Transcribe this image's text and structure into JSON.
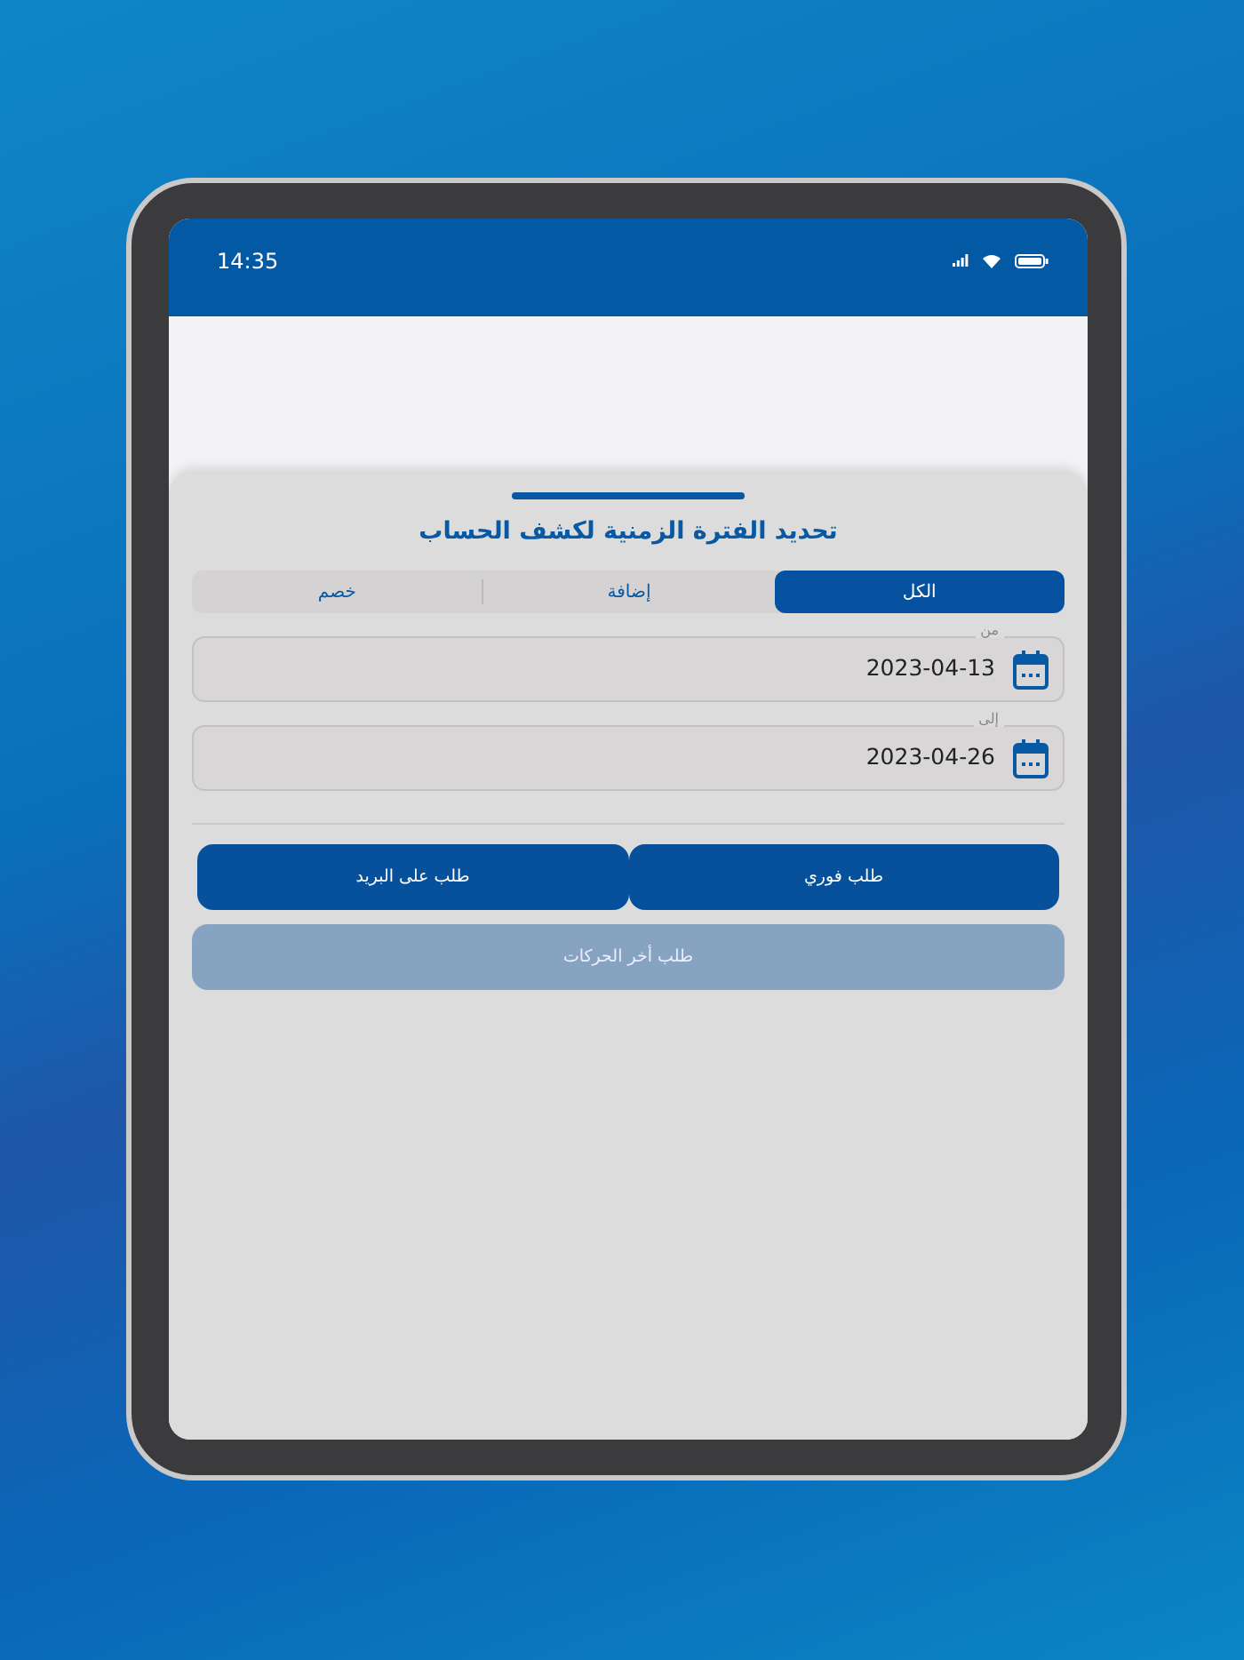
{
  "status_bar": {
    "time": "14:35"
  },
  "sheet": {
    "title": "تحديد الفترة الزمنية لكشف الحساب",
    "tabs": [
      {
        "label": "الكل",
        "selected": true
      },
      {
        "label": "إضافة",
        "selected": false
      },
      {
        "label": "خصم",
        "selected": false
      }
    ],
    "fields": [
      {
        "label": "من",
        "value": "2023-04-13"
      },
      {
        "label": "إلى",
        "value": "2023-04-26"
      }
    ],
    "buttons": [
      {
        "label": "طلب فوري",
        "disabled": false
      },
      {
        "label": "طلب على البريد",
        "disabled": false
      },
      {
        "label": "طلب أخر الحركات",
        "disabled": true
      }
    ]
  }
}
